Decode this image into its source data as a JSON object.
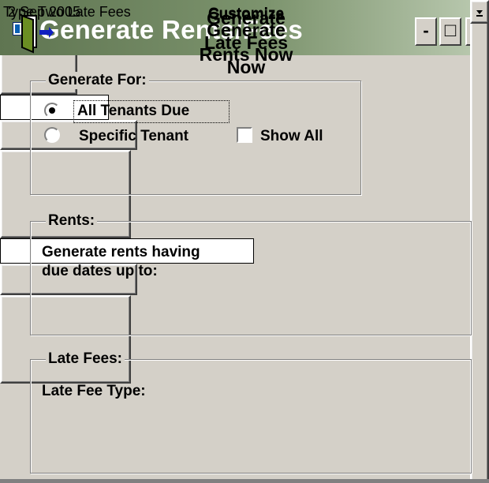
{
  "window": {
    "title": "Generate Rents/Fees",
    "minimize_label": "-",
    "maximize_label": "□",
    "close_label": "×"
  },
  "generate_for": {
    "group_label": "Generate For:",
    "option_all": "All Tenants Due",
    "option_specific": "Specific Tenant",
    "selected_option": "All Tenants Due",
    "show_all_label": "Show All",
    "show_all_checked": false,
    "tenant_value": ""
  },
  "exit_button": {
    "icon": "exit-door-icon"
  },
  "rents": {
    "group_label": "Rents:",
    "line1": "Generate rents having",
    "line2": "due dates up to:",
    "due_date": "2 Sep 2005",
    "customize_label": "Customize",
    "generate_line1": "Generate",
    "generate_line2": "Rents Now"
  },
  "late_fees": {
    "group_label": "Late Fees:",
    "type_label": "Late Fee Type:",
    "type_value": "Type Two Late Fees",
    "customize_label": "Customize",
    "generate_line1": "Generate",
    "generate_line2": "Late Fees",
    "generate_line3": "Now"
  },
  "colors": {
    "titlebar_start": "#5f7551",
    "titlebar_end": "#bccbb2",
    "face": "#d4d0c8",
    "door_green": "#6b8e23",
    "arrow_blue": "#1020c0"
  }
}
